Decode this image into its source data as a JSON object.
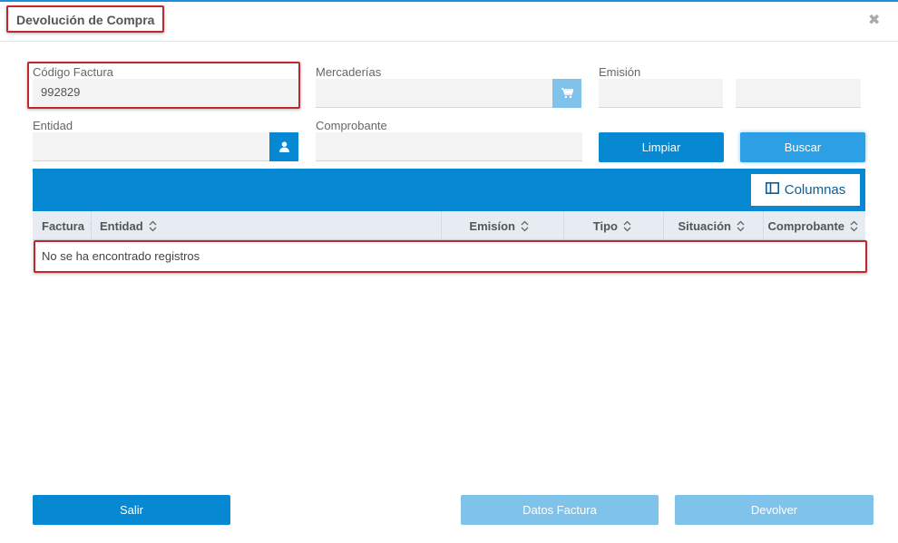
{
  "dialog": {
    "title": "Devolución de Compra"
  },
  "form": {
    "codigo_factura": {
      "label": "Código Factura",
      "value": "992829"
    },
    "mercaderias": {
      "label": "Mercaderías",
      "value": ""
    },
    "emision": {
      "label": "Emisión",
      "value_from": "",
      "value_to": ""
    },
    "entidad": {
      "label": "Entidad",
      "value": ""
    },
    "comprobante": {
      "label": "Comprobante",
      "value": ""
    }
  },
  "buttons": {
    "limpiar": "Limpiar",
    "buscar": "Buscar",
    "columnas": "Columnas",
    "salir": "Salir",
    "datos_factura": "Datos Factura",
    "devolver": "Devolver"
  },
  "table": {
    "columns": [
      "Factura",
      "Entidad",
      "Emisíon",
      "Tipo",
      "Situación",
      "Comprobante"
    ],
    "empty_message": "No se ha encontrado registros"
  },
  "colors": {
    "primary": "#0788d2",
    "highlight": "#c0282d",
    "disabled": "#7fc2ea"
  }
}
